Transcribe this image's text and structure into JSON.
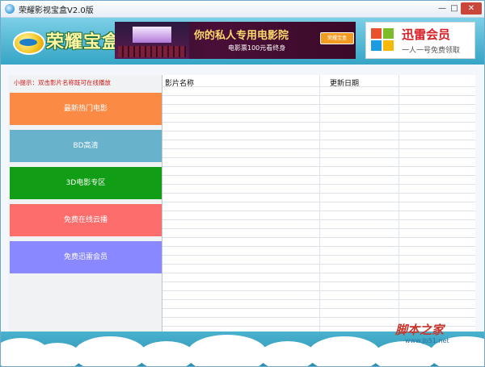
{
  "window": {
    "title": "荣耀影视宝盒V2.0版",
    "min_glyph": "—",
    "max_glyph": "□",
    "close_glyph": "✕"
  },
  "header": {
    "logo_text": "荣耀宝盒",
    "banner1": {
      "main": "你的私人专用电影院",
      "sub": "电影票100元看终身",
      "button": "荣耀宝盒"
    },
    "banner2": {
      "title": "迅雷会员",
      "sub": "一人一号免费领取"
    },
    "colors": {
      "header_top": "#7ccfe6",
      "header_bottom": "#35a5c6",
      "logo_text": "#fff5a0"
    }
  },
  "sidebar": {
    "hint": "小提示：双击影片名称既可在线播放",
    "categories": [
      {
        "label": "最新热门电影",
        "color": "#fb8a45"
      },
      {
        "label": "BD高清",
        "color": "#69b2cb"
      },
      {
        "label": "3D电影专区",
        "color": "#119e16"
      },
      {
        "label": "免费在线云播",
        "color": "#fc6d6c"
      },
      {
        "label": "免费迅雷会员",
        "color": "#8a88ff"
      }
    ]
  },
  "table": {
    "columns": [
      "影片名称",
      "更新日期",
      ""
    ],
    "rows": []
  },
  "watermark": {
    "main": "脚本之家",
    "sub": "www.jb51.net"
  }
}
